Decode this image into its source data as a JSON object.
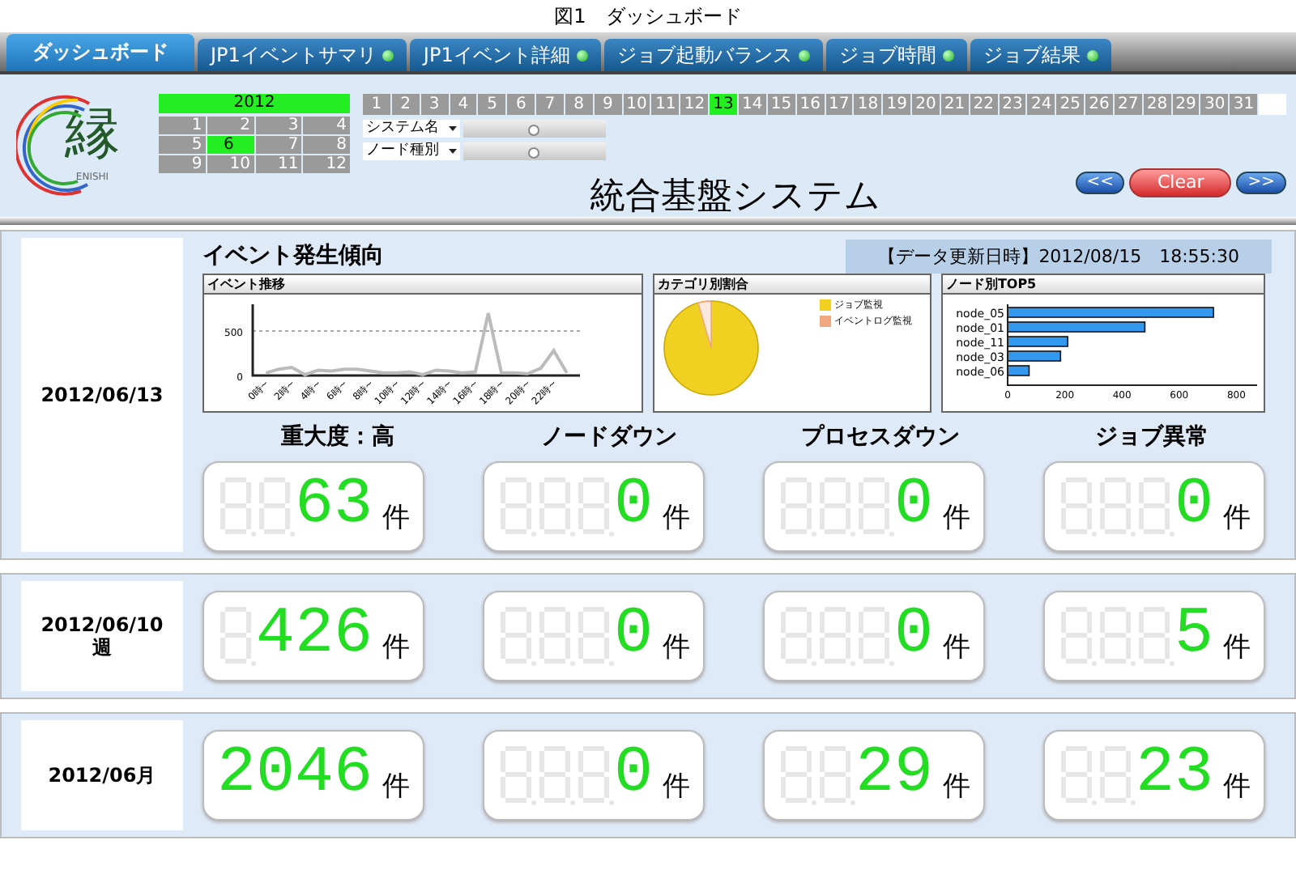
{
  "caption": "図1　ダッシュボード",
  "tabs": [
    {
      "label": "ダッシュボード",
      "selected": true,
      "status_dot": false
    },
    {
      "label": "JP1イベントサマリ",
      "selected": false,
      "status_dot": true
    },
    {
      "label": "JP1イベント詳細",
      "selected": false,
      "status_dot": true
    },
    {
      "label": "ジョブ起動バランス",
      "selected": false,
      "status_dot": true
    },
    {
      "label": "ジョブ時間",
      "selected": false,
      "status_dot": true
    },
    {
      "label": "ジョブ結果",
      "selected": false,
      "status_dot": true
    }
  ],
  "header": {
    "logo": {
      "glyph": "縁",
      "wordmark": "ENISHI"
    },
    "year": "2012",
    "months": [
      {
        "label": "1",
        "selected": false
      },
      {
        "label": "2",
        "selected": false
      },
      {
        "label": "3",
        "selected": false
      },
      {
        "label": "4",
        "selected": false
      },
      {
        "label": "5",
        "selected": false
      },
      {
        "label": "6",
        "selected": true
      },
      {
        "label": "7",
        "selected": false
      },
      {
        "label": "8",
        "selected": false
      },
      {
        "label": "9",
        "selected": false
      },
      {
        "label": "10",
        "selected": false
      },
      {
        "label": "11",
        "selected": false
      },
      {
        "label": "12",
        "selected": false
      }
    ],
    "days": [
      {
        "label": "1",
        "selected": false
      },
      {
        "label": "2",
        "selected": false
      },
      {
        "label": "3",
        "selected": false
      },
      {
        "label": "4",
        "selected": false
      },
      {
        "label": "5",
        "selected": false
      },
      {
        "label": "6",
        "selected": false
      },
      {
        "label": "7",
        "selected": false
      },
      {
        "label": "8",
        "selected": false
      },
      {
        "label": "9",
        "selected": false
      },
      {
        "label": "10",
        "selected": false
      },
      {
        "label": "11",
        "selected": false
      },
      {
        "label": "12",
        "selected": false
      },
      {
        "label": "13",
        "selected": true
      },
      {
        "label": "14",
        "selected": false
      },
      {
        "label": "15",
        "selected": false
      },
      {
        "label": "16",
        "selected": false
      },
      {
        "label": "17",
        "selected": false
      },
      {
        "label": "18",
        "selected": false
      },
      {
        "label": "19",
        "selected": false
      },
      {
        "label": "20",
        "selected": false
      },
      {
        "label": "21",
        "selected": false
      },
      {
        "label": "22",
        "selected": false
      },
      {
        "label": "23",
        "selected": false
      },
      {
        "label": "24",
        "selected": false
      },
      {
        "label": "25",
        "selected": false
      },
      {
        "label": "26",
        "selected": false
      },
      {
        "label": "27",
        "selected": false
      },
      {
        "label": "28",
        "selected": false
      },
      {
        "label": "29",
        "selected": false
      },
      {
        "label": "30",
        "selected": false
      },
      {
        "label": "31",
        "selected": false
      }
    ],
    "filters": [
      {
        "label": "システム名",
        "level": 0.45
      },
      {
        "label": "ノード種別",
        "level": 0.45
      }
    ],
    "title": "統合基盤システム",
    "buttons": [
      {
        "label": "<<",
        "kind": "nav"
      },
      {
        "label": "Clear",
        "kind": "clear"
      },
      {
        "label": ">>",
        "kind": "nav"
      }
    ]
  },
  "sections": [
    {
      "date": "2012/06/13",
      "trend": {
        "title": "イベント発生傾向",
        "updated": "【データ更新日時】2012/08/15　18:55:30",
        "line_chart": {
          "title": "イベント推移",
          "chart_data": {
            "type": "line",
            "x": [
              0,
              1,
              2,
              3,
              4,
              5,
              6,
              7,
              8,
              9,
              10,
              11,
              12,
              13,
              14,
              15,
              16,
              17,
              18,
              19,
              20,
              21,
              22,
              23
            ],
            "xticks": [
              {
                "value": 0,
                "label": "0時~"
              },
              {
                "value": 2,
                "label": "2時~"
              },
              {
                "value": 4,
                "label": "4時~"
              },
              {
                "value": 6,
                "label": "6時~"
              },
              {
                "value": 8,
                "label": "8時~"
              },
              {
                "value": 10,
                "label": "10時~"
              },
              {
                "value": 12,
                "label": "12時~"
              },
              {
                "value": 14,
                "label": "14時~"
              },
              {
                "value": 16,
                "label": "16時~"
              },
              {
                "value": 18,
                "label": "18時~"
              },
              {
                "value": 20,
                "label": "20時~"
              },
              {
                "value": 22,
                "label": "22時~"
              }
            ],
            "yticks": [
              0,
              500
            ],
            "ylim": [
              0,
              800
            ],
            "xlim": [
              -1,
              24
            ],
            "series": [
              {
                "color": "#bbbbbb",
                "values": [
                  30,
                  70,
                  90,
                  10,
                  60,
                  50,
                  70,
                  70,
                  50,
                  30,
                  30,
                  40,
                  10,
                  60,
                  50,
                  30,
                  40,
                  700,
                  30,
                  30,
                  20,
                  80,
                  280,
                  30
                ]
              }
            ]
          }
        },
        "pie_chart": {
          "title": "カテゴリ別割合",
          "legend": [
            {
              "label": "ジョブ監視",
              "color": "#f0d020"
            },
            {
              "label": "イベントログ監視",
              "color": "#f0a880"
            }
          ]
        },
        "bar_chart": {
          "title": "ノード別TOP5",
          "chart_data": {
            "type": "bar",
            "orientation": "horizontal",
            "categories": [
              "node_05",
              "node_01",
              "node_11",
              "node_03",
              "node_06"
            ],
            "xlim": [
              0,
              850
            ],
            "xticks": [
              0,
              200,
              400,
              600,
              800
            ],
            "series": [
              {
                "color": "#3399ee",
                "values": [
                  720,
                  480,
                  210,
                  185,
                  75
                ]
              }
            ]
          }
        }
      },
      "metrics": [
        {
          "label": "重大度：高",
          "value": "63",
          "unit": "件"
        },
        {
          "label": "ノードダウン",
          "value": "0",
          "unit": "件"
        },
        {
          "label": "プロセスダウン",
          "value": "0",
          "unit": "件"
        },
        {
          "label": "ジョブ異常",
          "value": "0",
          "unit": "件"
        }
      ]
    },
    {
      "date": "2012/06/10",
      "period": "週",
      "metrics": [
        {
          "value": "426",
          "unit": "件"
        },
        {
          "value": "0",
          "unit": "件"
        },
        {
          "value": "0",
          "unit": "件"
        },
        {
          "value": "5",
          "unit": "件"
        }
      ]
    },
    {
      "date": "2012/06月",
      "metrics": [
        {
          "value": "2046",
          "unit": "件"
        },
        {
          "value": "0",
          "unit": "件"
        },
        {
          "value": "29",
          "unit": "件"
        },
        {
          "value": "23",
          "unit": "件"
        }
      ]
    }
  ]
}
